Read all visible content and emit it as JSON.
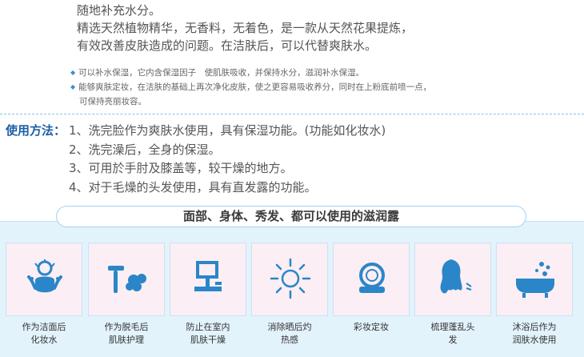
{
  "intro": {
    "lines": [
      "随地补充水分。",
      "精选天然植物精华，无香料，无着色，是一款从天然花果提炼，",
      "有效改善皮肤造成的问题。在洁肤后，可以代替爽肤水。"
    ],
    "bullets": [
      "可以补水保湿，它内含保湿因子　使肌肤吸收，并保持水分，滋润补水保湿。",
      "能够爽肤定妆，在洁肤的基础上再次净化皮肤，使之更容易吸收养分，同时在上粉底前喷一点，",
      "可保持亮丽妆容。"
    ]
  },
  "usage": {
    "label": "使用方法：",
    "items": [
      "1、洗完脸作为爽肤水使用，具有保湿功能。(功能如化妆水)",
      "2、洗完澡后，全身的保湿。",
      "3、可用於手肘及膝盖等，较干燥的地方。",
      "4、对于毛燥的头发使用，具有直发露的功能。"
    ]
  },
  "banner": {
    "title": "面部、身体、秀发、都可以使用的滋润露"
  },
  "features": [
    {
      "icon": "face-wash-icon",
      "caption_1": "作为洁面后",
      "caption_2": "化妆水"
    },
    {
      "icon": "razor-icon",
      "caption_1": "作为脱毛后",
      "caption_2": "肌肤护理"
    },
    {
      "icon": "computer-icon",
      "caption_1": "防止在室内",
      "caption_2": "肌肤干燥"
    },
    {
      "icon": "sun-icon",
      "caption_1": "消除晒后灼",
      "caption_2": "热感"
    },
    {
      "icon": "compact-mirror-icon",
      "caption_1": "彩妆定妆",
      "caption_2": ""
    },
    {
      "icon": "hair-icon",
      "caption_1": "梳理蓬乱头",
      "caption_2": "发"
    },
    {
      "icon": "bathtub-icon",
      "caption_1": "沐浴后作为",
      "caption_2": "润肤水使用"
    }
  ],
  "colors": {
    "accent": "#3a8fd6",
    "label_blue": "#1d5fa8",
    "card_bg": "#fbeef4",
    "panel_bg": "#e3f3fc"
  }
}
